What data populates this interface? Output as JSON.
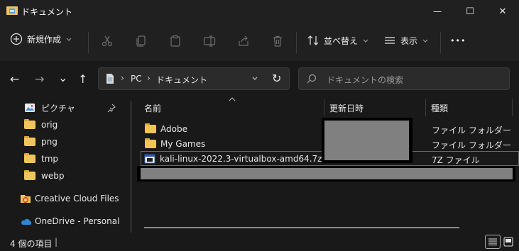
{
  "window": {
    "title": "ドキュメント",
    "minimize_glyph": "—",
    "maximize_glyph": "☐",
    "close_glyph": "✕"
  },
  "toolbar": {
    "new_label": "新規作成",
    "sort_label": "並べ替え",
    "view_label": "表示",
    "more_glyph": "•••"
  },
  "nav": {
    "back": "←",
    "forward": "→",
    "recent": "⌄",
    "up": "↑",
    "refresh": "↻"
  },
  "address": {
    "segments": [
      "PC",
      "ドキュメント"
    ],
    "sep": "›"
  },
  "search": {
    "placeholder": "ドキュメントの検索"
  },
  "sidebar": {
    "items": [
      {
        "label": "ピクチャ",
        "icon": "pictures-icon",
        "pinned": true
      },
      {
        "label": "orig",
        "icon": "folder-icon"
      },
      {
        "label": "png",
        "icon": "folder-icon"
      },
      {
        "label": "tmp",
        "icon": "folder-icon"
      },
      {
        "label": "webp",
        "icon": "folder-icon"
      },
      {
        "label": "Creative Cloud Files",
        "icon": "creative-cloud-icon"
      },
      {
        "label": "OneDrive - Personal",
        "icon": "onedrive-icon"
      }
    ]
  },
  "columns": {
    "name": "名前",
    "modified": "更新日時",
    "type": "種類"
  },
  "files": [
    {
      "name": "Adobe",
      "type": "ファイル フォルダー",
      "icon": "folder-icon"
    },
    {
      "name": "My Games",
      "type": "ファイル フォルダー",
      "icon": "folder-icon"
    },
    {
      "name": "kali-linux-2022.3-virtualbox-amd64.7z",
      "type": "7Z ファイル",
      "icon": "7z-file-icon"
    }
  ],
  "status": {
    "count": "4 個の項目",
    "separator": "|"
  },
  "colors": {
    "background": "#191919",
    "chrome": "#202020",
    "folder": "#f2c55c",
    "redaction": "#808080"
  }
}
